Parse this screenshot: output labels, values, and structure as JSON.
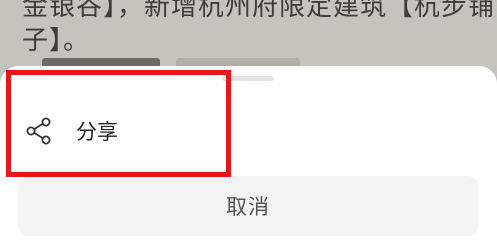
{
  "background": {
    "line1": "金银谷】，新增杭州府限定建筑【杭步铺",
    "line2": "子】。"
  },
  "share_sheet": {
    "share_label": "分享",
    "share_icon": "share-icon",
    "cancel_label": "取消"
  },
  "colors": {
    "highlight": "#e8161b",
    "sheet_bg": "#ffffff",
    "cancel_bg": "#f3f3f3",
    "overlay": "#c4c3bc"
  }
}
